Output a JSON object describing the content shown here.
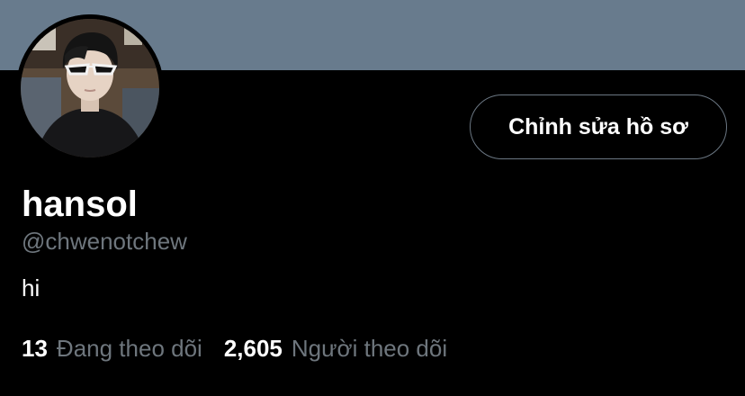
{
  "banner": {
    "color": "#687b8d"
  },
  "profile": {
    "display_name": "hansol",
    "handle": "@chwenotchew",
    "bio": "hi",
    "edit_button_label": "Chỉnh sửa hồ sơ"
  },
  "stats": {
    "following_count": "13",
    "following_label": "Đang theo dõi",
    "followers_count": "2,605",
    "followers_label": "Người theo dõi"
  },
  "colors": {
    "background": "#000000",
    "text_primary": "#ffffff",
    "text_secondary": "#6e767d",
    "button_border": "#6b7783"
  }
}
